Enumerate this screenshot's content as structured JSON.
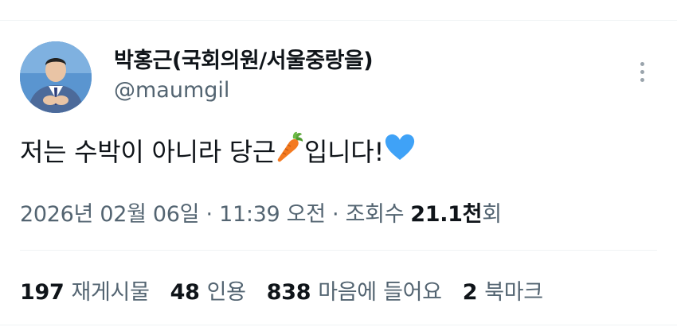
{
  "author": {
    "name": "박홍근(국회의원/서울중랑을)",
    "handle": "@maumgil"
  },
  "tweet": {
    "text_before_emoji": "저는 수박이 아니라 당근",
    "emoji_1": "carrot",
    "text_after_emoji": "입니다!",
    "emoji_2": "blue-heart"
  },
  "meta": {
    "date": "2026년 02월 06일",
    "separator_1": " · ",
    "time": "11:39 오전",
    "separator_2": " · ",
    "views_label": "조회수",
    "views_count": "21.1천",
    "views_suffix": "회"
  },
  "stats": [
    {
      "value": "197",
      "label": "재게시물"
    },
    {
      "value": "48",
      "label": "인용"
    },
    {
      "value": "838",
      "label": "마음에 들어요"
    },
    {
      "value": "2",
      "label": "북마크"
    }
  ],
  "colors": {
    "primary_text": "#0f1419",
    "secondary_text": "#536471",
    "divider": "#eff3f4",
    "heart": "#3fa2f7",
    "carrot": "#f47a20",
    "carrot_leaf": "#5fa83b"
  },
  "icons": {
    "more": "more-vertical-icon"
  }
}
